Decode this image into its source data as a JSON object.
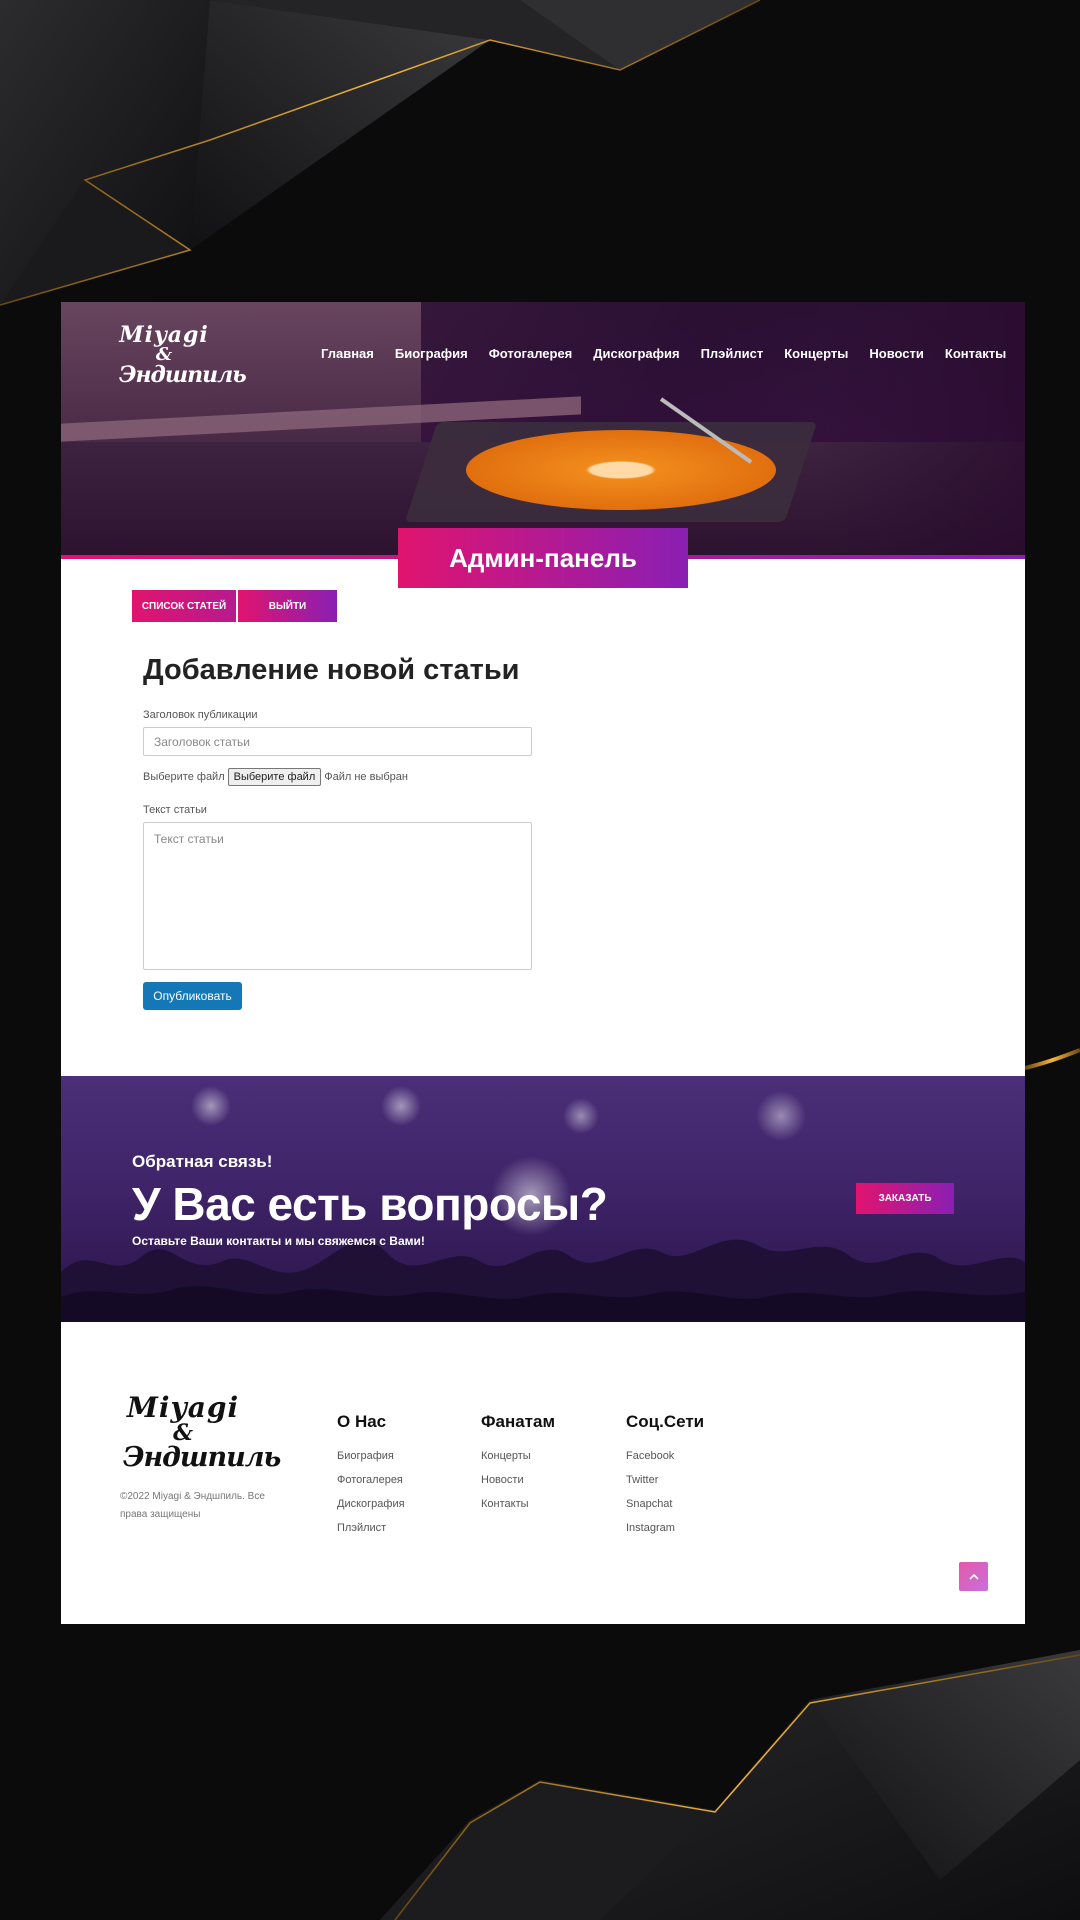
{
  "header": {
    "logo": {
      "line1": "Miyagi",
      "line2": "&",
      "line3": "Эндшпиль"
    },
    "nav": [
      "Главная",
      "Биография",
      "Фотогалерея",
      "Дискография",
      "Плэйлист",
      "Концерты",
      "Новости",
      "Контакты"
    ],
    "admin_title": "Админ-панель"
  },
  "admin_buttons": {
    "articles_list": "СПИСОК СТАТЕЙ",
    "logout": "ВЫЙТИ"
  },
  "form": {
    "title": "Добавление новой статьи",
    "headline_label": "Заголовок публикации",
    "headline_placeholder": "Заголовок статьи",
    "file_label": "Выберите файл",
    "file_button": "Выберите файл",
    "file_status": "Файл не выбран",
    "text_label": "Текст статьи",
    "text_placeholder": "Текст статьи",
    "publish": "Опубликовать"
  },
  "cta": {
    "subtitle": "Обратная связь!",
    "title": "У Вас есть вопросы?",
    "text": "Оставьте Ваши контакты и мы свяжемся с Вами!",
    "button": "ЗАКАЗАТЬ"
  },
  "footer": {
    "logo": {
      "line1": "Miyagi",
      "line2": "&",
      "line3": "Эндшпиль"
    },
    "copyright": "©2022 Miyagi & Эндшпиль. Все права защищены",
    "columns": [
      {
        "title": "О Нас",
        "links": [
          "Биография",
          "Фотогалерея",
          "Дискография",
          "Плэйлист"
        ]
      },
      {
        "title": "Фанатам",
        "links": [
          "Концерты",
          "Новости",
          "Контакты"
        ]
      },
      {
        "title": "Соц.Сети",
        "links": [
          "Facebook",
          "Twitter",
          "Snapchat",
          "Instagram"
        ]
      }
    ],
    "scroll_top_icon": "chevron-up-icon"
  },
  "colors": {
    "gradient_start": "#e0146f",
    "gradient_end": "#8a1fb3",
    "publish_button": "#1578b6",
    "background": "#0b0b0c"
  }
}
